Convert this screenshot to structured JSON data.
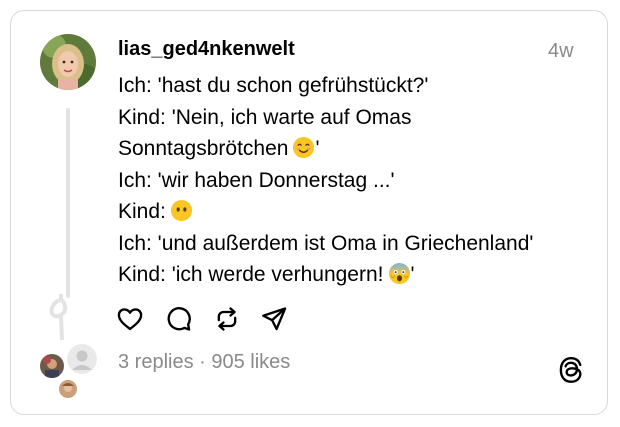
{
  "post": {
    "username": "lias_ged4nkenwelt",
    "time": "4w",
    "lines": [
      {
        "text": "Ich: 'hast du schon gefrühstückt?'",
        "emoji": "",
        "after": ""
      },
      {
        "text": "Kind: 'Nein, ich warte auf Omas",
        "emoji": "",
        "after": ""
      },
      {
        "text": "Sonntagsbrötchen",
        "emoji": "smiling-face-emoji",
        "after": "'"
      },
      {
        "text": "Ich: 'wir haben Donnerstag ...'",
        "emoji": "",
        "after": ""
      },
      {
        "text": "Kind:",
        "emoji": "face-without-mouth-emoji",
        "after": ""
      },
      {
        "text": "Ich: 'und außerdem ist Oma in Griechenland'",
        "emoji": "",
        "after": ""
      },
      {
        "text": "Kind: 'ich werde verhungern!",
        "emoji": "screaming-face-emoji",
        "after": "'"
      }
    ],
    "actions": [
      "heart-icon",
      "comment-icon",
      "repost-icon",
      "share-icon"
    ],
    "stats": "3 replies · 905 likes"
  },
  "colors": {
    "muted_text": "#8a8a8a",
    "border": "#d9d9d9",
    "thread_line": "#e3e3e3"
  }
}
